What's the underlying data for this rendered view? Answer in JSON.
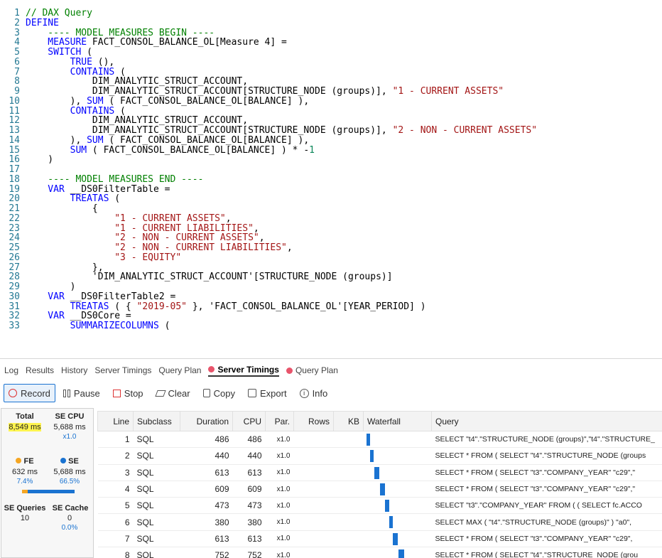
{
  "editor": {
    "lines": [
      [
        [
          "cm",
          "// DAX Query"
        ]
      ],
      [
        [
          "kw",
          "DEFINE"
        ]
      ],
      [
        [
          "cm",
          "    ---- MODEL MEASURES BEGIN ----"
        ]
      ],
      [
        [
          "kw",
          "    MEASURE "
        ],
        [
          "",
          "FACT_CONSOL_BALANCE_OL[Measure 4] ="
        ]
      ],
      [
        [
          "kw",
          "    SWITCH"
        ],
        [
          "",
          " ("
        ]
      ],
      [
        [
          "kw",
          "        TRUE"
        ],
        [
          "",
          " (),"
        ]
      ],
      [
        [
          "kw",
          "        CONTAINS"
        ],
        [
          "",
          " ("
        ]
      ],
      [
        [
          "",
          "            DIM_ANALYTIC_STRUCT_ACCOUNT,"
        ]
      ],
      [
        [
          "",
          "            DIM_ANALYTIC_STRUCT_ACCOUNT[STRUCTURE_NODE (groups)], "
        ],
        [
          "str",
          "\"1 - CURRENT ASSETS\""
        ]
      ],
      [
        [
          "",
          "        ), "
        ],
        [
          "kw",
          "SUM"
        ],
        [
          "",
          " ( FACT_CONSOL_BALANCE_OL[BALANCE] ),"
        ]
      ],
      [
        [
          "kw",
          "        CONTAINS"
        ],
        [
          "",
          " ("
        ]
      ],
      [
        [
          "",
          "            DIM_ANALYTIC_STRUCT_ACCOUNT,"
        ]
      ],
      [
        [
          "",
          "            DIM_ANALYTIC_STRUCT_ACCOUNT[STRUCTURE_NODE (groups)], "
        ],
        [
          "str",
          "\"2 - NON - CURRENT ASSETS\""
        ]
      ],
      [
        [
          "",
          "        ), "
        ],
        [
          "kw",
          "SUM"
        ],
        [
          "",
          " ( FACT_CONSOL_BALANCE_OL[BALANCE] ),"
        ]
      ],
      [
        [
          "kw",
          "        SUM"
        ],
        [
          "",
          " ( FACT_CONSOL_BALANCE_OL[BALANCE] ) * -"
        ],
        [
          "num",
          "1"
        ]
      ],
      [
        [
          "",
          "    )"
        ]
      ],
      [
        [
          "",
          ""
        ]
      ],
      [
        [
          "cm",
          "    ---- MODEL MEASURES END ----"
        ]
      ],
      [
        [
          "kw",
          "    VAR "
        ],
        [
          "",
          "__DS0FilterTable ="
        ]
      ],
      [
        [
          "kw",
          "        TREATAS"
        ],
        [
          "",
          " ("
        ]
      ],
      [
        [
          "",
          "            {"
        ]
      ],
      [
        [
          "str",
          "                \"1 - CURRENT ASSETS\""
        ],
        [
          "",
          ","
        ]
      ],
      [
        [
          "str",
          "                \"1 - CURRENT LIABILITIES\""
        ],
        [
          "",
          ","
        ]
      ],
      [
        [
          "str",
          "                \"2 - NON - CURRENT ASSETS\""
        ],
        [
          "",
          ","
        ]
      ],
      [
        [
          "str",
          "                \"2 - NON - CURRENT LIABILITIES\""
        ],
        [
          "",
          ","
        ]
      ],
      [
        [
          "str",
          "                \"3 - EQUITY\""
        ]
      ],
      [
        [
          "",
          "            },"
        ]
      ],
      [
        [
          "",
          "            'DIM_ANALYTIC_STRUCT_ACCOUNT'[STRUCTURE_NODE (groups)]"
        ]
      ],
      [
        [
          "",
          "        )"
        ]
      ],
      [
        [
          "kw",
          "    VAR "
        ],
        [
          "",
          "__DS0FilterTable2 ="
        ]
      ],
      [
        [
          "kw",
          "        TREATAS"
        ],
        [
          "",
          " ( { "
        ],
        [
          "str",
          "\"2019-05\""
        ],
        [
          "",
          " }, 'FACT_CONSOL_BALANCE_OL'[YEAR_PERIOD] )"
        ]
      ],
      [
        [
          "kw",
          "    VAR "
        ],
        [
          "",
          "__DS0Core ="
        ]
      ],
      [
        [
          "kw",
          "        SUMMARIZECOLUMNS"
        ],
        [
          "",
          " ("
        ]
      ]
    ]
  },
  "tabs": [
    {
      "label": "Log",
      "dot": false,
      "active": false
    },
    {
      "label": "Results",
      "dot": false,
      "active": false
    },
    {
      "label": "History",
      "dot": false,
      "active": false
    },
    {
      "label": "Server Timings",
      "dot": false,
      "active": false
    },
    {
      "label": "Query Plan",
      "dot": false,
      "active": false
    },
    {
      "label": "Server Timings",
      "dot": true,
      "active": true
    },
    {
      "label": "Query Plan",
      "dot": true,
      "active": false
    }
  ],
  "toolbar": {
    "record": "Record",
    "pause": "Pause",
    "stop": "Stop",
    "clear": "Clear",
    "copy": "Copy",
    "export": "Export",
    "info": "Info"
  },
  "summary": {
    "total_label": "Total",
    "total_value": "8,549 ms",
    "secpu_label": "SE CPU",
    "secpu_value": "5,688 ms",
    "secpu_sub": "x1.0",
    "fe_label": "FE",
    "fe_value": "632 ms",
    "fe_pct": "7.4%",
    "se_label": "SE",
    "se_value": "5,688 ms",
    "se_pct": "66.5%",
    "sequeries_label": "SE Queries",
    "sequeries_value": "10",
    "secache_label": "SE Cache",
    "secache_value": "0",
    "secache_pct": "0.0%",
    "colors": {
      "fe": "#f5a623",
      "se": "#1a73d1",
      "highlight": "#fff44f"
    }
  },
  "table": {
    "columns": [
      "Line",
      "Subclass",
      "Duration",
      "CPU",
      "Par.",
      "Rows",
      "KB",
      "Waterfall",
      "Query"
    ],
    "rows": [
      {
        "line": "1",
        "subclass": "SQL",
        "duration": "486",
        "cpu": "486",
        "par": "x1.0",
        "rows": "",
        "kb": "",
        "wf_start": 0.0,
        "wf_width": 0.057,
        "query": "SELECT \"t4\".\"STRUCTURE_NODE (groups)\",\"t4\".\"STRUCTURE_"
      },
      {
        "line": "2",
        "subclass": "SQL",
        "duration": "440",
        "cpu": "440",
        "par": "x1.0",
        "rows": "",
        "kb": "",
        "wf_start": 0.06,
        "wf_width": 0.051,
        "query": "SELECT * FROM  ( SELECT \"t4\".\"STRUCTURE_NODE (groups"
      },
      {
        "line": "3",
        "subclass": "SQL",
        "duration": "613",
        "cpu": "613",
        "par": "x1.0",
        "rows": "",
        "kb": "",
        "wf_start": 0.12,
        "wf_width": 0.072,
        "query": "SELECT * FROM  ( SELECT \"t3\".\"COMPANY_YEAR\" \"c29\",\""
      },
      {
        "line": "4",
        "subclass": "SQL",
        "duration": "609",
        "cpu": "609",
        "par": "x1.0",
        "rows": "",
        "kb": "",
        "wf_start": 0.2,
        "wf_width": 0.071,
        "query": "SELECT * FROM  ( SELECT \"t3\".\"COMPANY_YEAR\" \"c29\",\""
      },
      {
        "line": "5",
        "subclass": "SQL",
        "duration": "473",
        "cpu": "473",
        "par": "x1.0",
        "rows": "",
        "kb": "",
        "wf_start": 0.28,
        "wf_width": 0.055,
        "query": "SELECT \"t3\".\"COMPANY_YEAR\" FROM  ( ( SELECT fc.ACCO"
      },
      {
        "line": "6",
        "subclass": "SQL",
        "duration": "380",
        "cpu": "380",
        "par": "x1.0",
        "rows": "",
        "kb": "",
        "wf_start": 0.34,
        "wf_width": 0.044,
        "query": "SELECT  MAX ( \"t4\".\"STRUCTURE_NODE (groups)\" )  \"a0\","
      },
      {
        "line": "7",
        "subclass": "SQL",
        "duration": "613",
        "cpu": "613",
        "par": "x1.0",
        "rows": "",
        "kb": "",
        "wf_start": 0.39,
        "wf_width": 0.072,
        "query": "SELECT * FROM  ( SELECT \"t3\".\"COMPANY_YEAR\" \"c29\","
      },
      {
        "line": "8",
        "subclass": "SQL",
        "duration": "752",
        "cpu": "752",
        "par": "x1.0",
        "rows": "",
        "kb": "",
        "wf_start": 0.47,
        "wf_width": 0.088,
        "query": "SELECT * FROM  ( SELECT \"t4\".\"STRUCTURE_NODE (grou"
      }
    ]
  }
}
